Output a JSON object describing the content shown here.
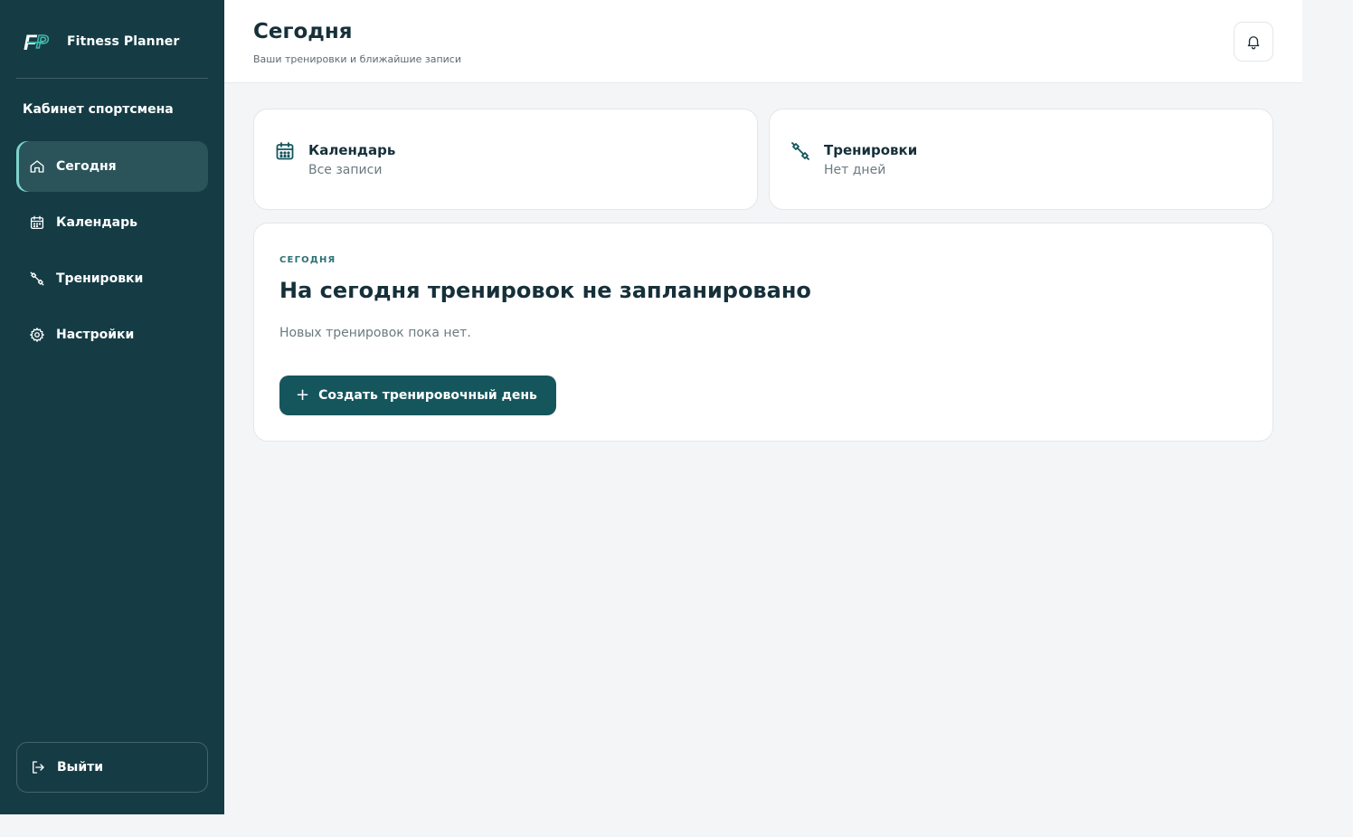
{
  "brand": {
    "name": "Fitness Planner",
    "logo_text": "FP"
  },
  "sidebar": {
    "section_title": "Кабинет спортсмена",
    "items": [
      {
        "label": "Сегодня",
        "icon": "home-icon",
        "active": true
      },
      {
        "label": "Календарь",
        "icon": "calendar-icon",
        "active": false
      },
      {
        "label": "Тренировки",
        "icon": "dumbbell-icon",
        "active": false
      },
      {
        "label": "Настройки",
        "icon": "gear-icon",
        "active": false
      }
    ],
    "logout_label": "Выйти"
  },
  "header": {
    "title": "Сегодня",
    "subtitle": "Ваши тренировки и ближайшие записи",
    "notifications_icon": "bell-icon"
  },
  "cards": [
    {
      "title": "Календарь",
      "subtitle": "Все записи",
      "icon": "calendar-icon"
    },
    {
      "title": "Тренировки",
      "subtitle": "Нет дней",
      "icon": "dumbbell-icon"
    }
  ],
  "today": {
    "eyebrow": "Сегодня",
    "title": "На сегодня тренировок не запланировано",
    "text": "Новых тренировок пока нет.",
    "create_button": "Создать тренировочный день"
  },
  "colors": {
    "sidebar_bg": "#153c45",
    "active_item_bg": "#2a5459",
    "accent": "#15565d",
    "eyebrow": "#2c7276",
    "page_bg": "#f4f5f7"
  }
}
